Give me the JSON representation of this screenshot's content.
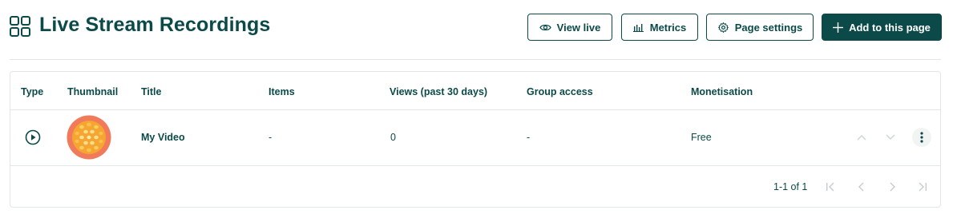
{
  "header": {
    "title": "Live Stream Recordings",
    "page_icon": "grid-icon",
    "buttons": {
      "view_live": "View live",
      "metrics": "Metrics",
      "page_settings": "Page settings",
      "add": "Add to this page"
    }
  },
  "table": {
    "columns": [
      "Type",
      "Thumbnail",
      "Title",
      "Items",
      "Views (past 30 days)",
      "Group access",
      "Monetisation"
    ],
    "rows": [
      {
        "type_icon": "play-circle-icon",
        "thumbnail": "passionfruit-thumbnail",
        "title": "My Video",
        "items": "-",
        "views": "0",
        "group_access": "-",
        "monetisation": "Free"
      }
    ]
  },
  "pagination": {
    "range": "1-1 of 1"
  },
  "colors": {
    "primary": "#0c4a4a",
    "border": "#e3e6e6",
    "thumb_outer": "#f07a5a",
    "thumb_inner": "#f6a532",
    "thumb_seed": "#f7c24a"
  }
}
